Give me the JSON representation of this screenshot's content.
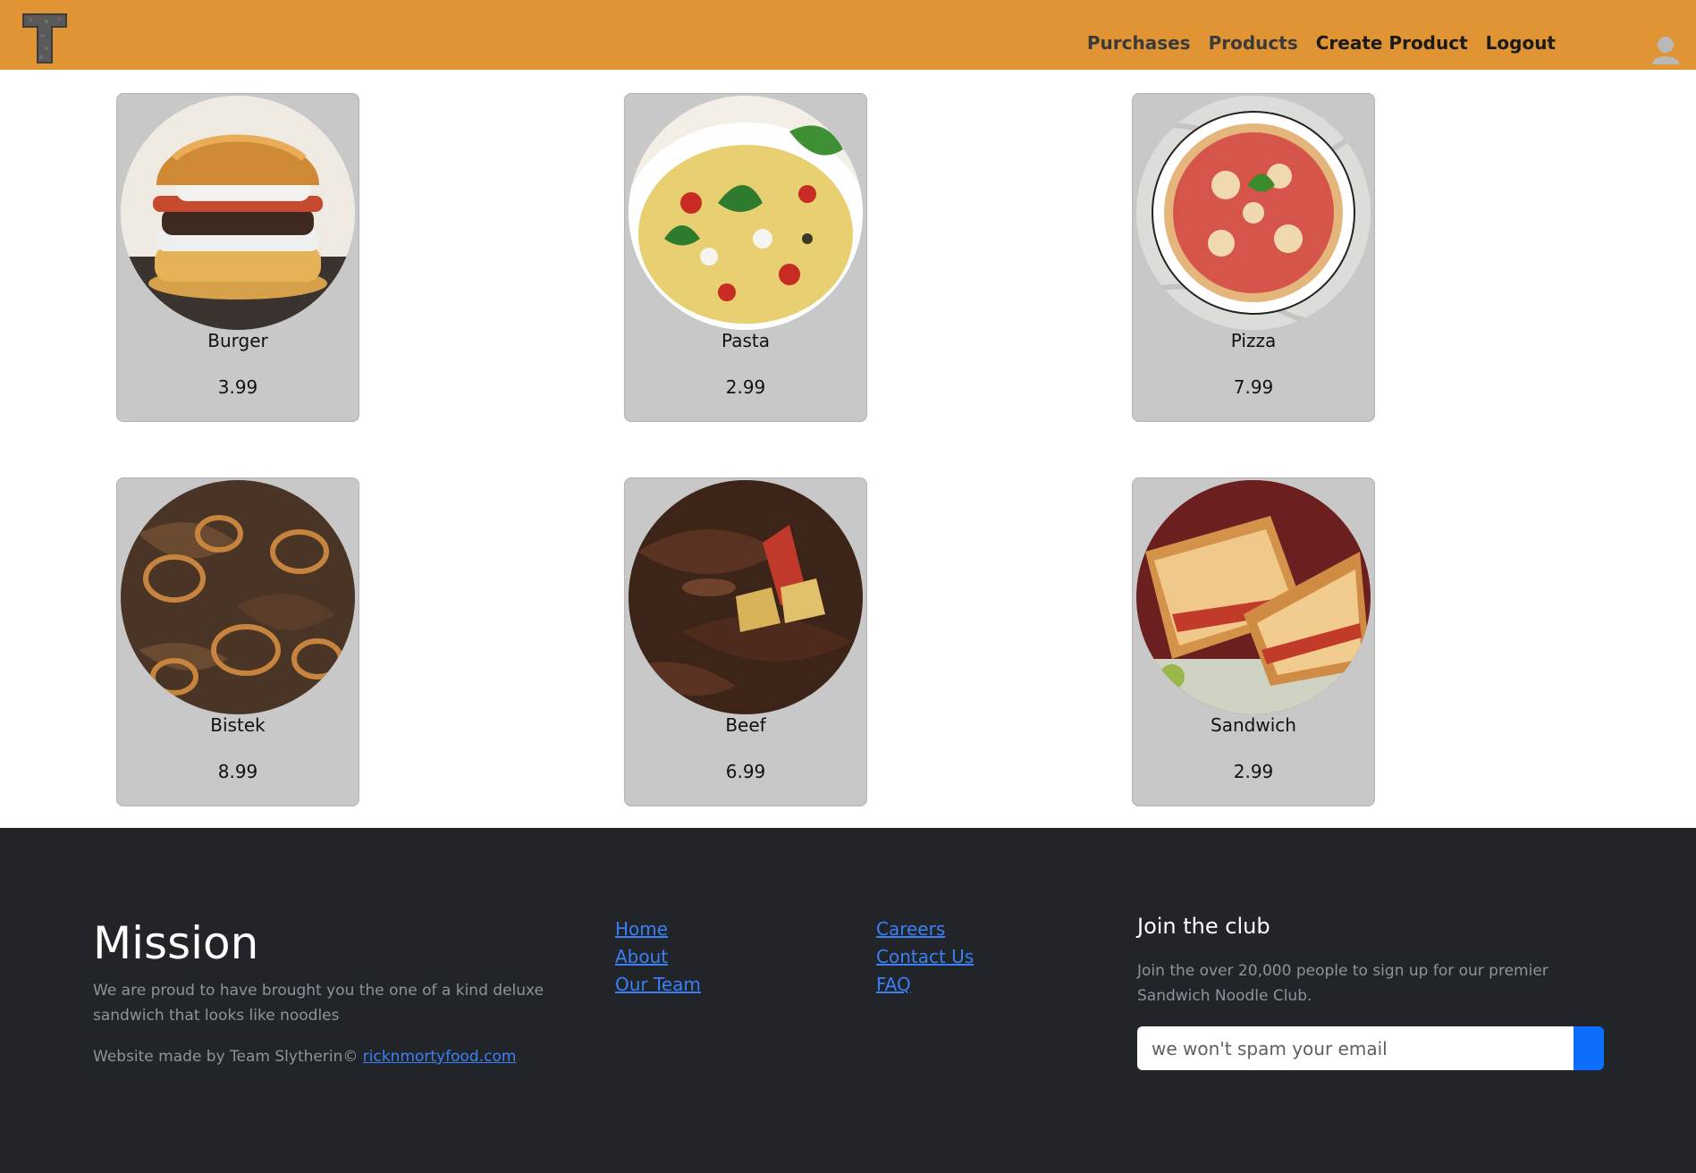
{
  "navbar": {
    "logo_letter": "T",
    "brand_color": "#e09433",
    "links": [
      {
        "label": "Purchases"
      },
      {
        "label": "Products"
      },
      {
        "label": "Create Product"
      },
      {
        "label": "Logout"
      }
    ],
    "avatar_icon": "user-avatar-icon"
  },
  "products": [
    {
      "name": "Burger",
      "price": "3.99",
      "image": "burger-image"
    },
    {
      "name": "Pasta",
      "price": "2.99",
      "image": "pasta-image"
    },
    {
      "name": "Pizza",
      "price": "7.99",
      "image": "pizza-image"
    },
    {
      "name": "Bistek",
      "price": "8.99",
      "image": "bistek-image"
    },
    {
      "name": "Beef",
      "price": "6.99",
      "image": "beef-image"
    },
    {
      "name": "Sandwich",
      "price": "2.99",
      "image": "sandwich-image"
    }
  ],
  "footer": {
    "background": "#212429",
    "mission_title": "Mission",
    "mission_text": "We are proud to have brought you the one of a kind deluxe sandwich that looks like noodles",
    "credit_text": "Website made by Team Slytherin© ",
    "credit_link": "ricknmortyfood.com",
    "links_col1": [
      "Home",
      "About",
      "Our Team"
    ],
    "links_col2": [
      "Careers",
      "Contact Us",
      "FAQ"
    ],
    "club_title": "Join the club",
    "club_text": "Join the over 20,000 people to sign up for our premier Sandwich Noodle Club.",
    "email_placeholder": "we won't spam your email",
    "button_color": "#0d6efd"
  }
}
